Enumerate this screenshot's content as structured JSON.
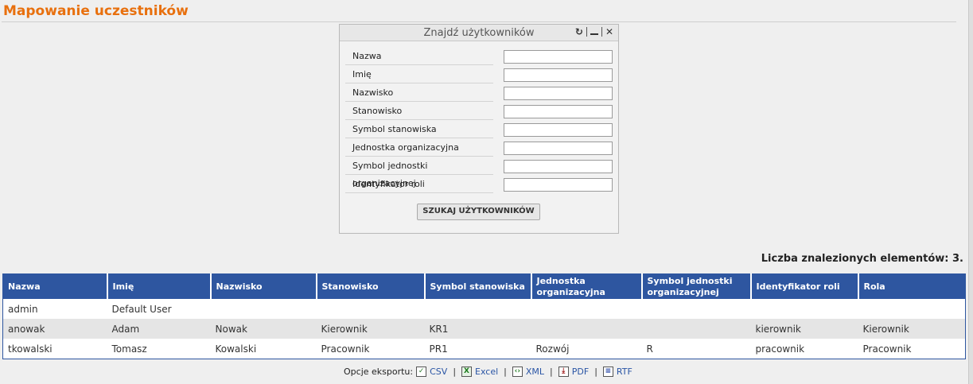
{
  "page": {
    "title": "Mapowanie uczestników"
  },
  "search_panel": {
    "title": "Znajdź użytkowników",
    "tools": {
      "refresh_icon": "↻",
      "close_icon": "✕"
    },
    "fields": [
      {
        "label": "Nazwa",
        "value": ""
      },
      {
        "label": "Imię",
        "value": ""
      },
      {
        "label": "Nazwisko",
        "value": ""
      },
      {
        "label": "Stanowisko",
        "value": ""
      },
      {
        "label": "Symbol stanowiska",
        "value": ""
      },
      {
        "label": "Jednostka organizacyjna",
        "value": ""
      },
      {
        "label": "Symbol jednostki organizacyjnej",
        "value": ""
      },
      {
        "label": "Identyfikator roli",
        "value": ""
      }
    ],
    "search_button": "SZUKAJ UŻYTKOWNIKÓW"
  },
  "results": {
    "count_text": "Liczba znalezionych elementów: 3.",
    "columns": [
      "Nazwa",
      "Imię",
      "Nazwisko",
      "Stanowisko",
      "Symbol stanowiska",
      "Jednostka organizacyjna",
      "Symbol jednostki organizacyjnej",
      "Identyfikator roli",
      "Rola"
    ],
    "rows": [
      [
        "admin",
        "Default User",
        "",
        "",
        "",
        "",
        "",
        "",
        ""
      ],
      [
        "anowak",
        "Adam",
        "Nowak",
        "Kierownik",
        "KR1",
        "",
        "",
        "kierownik",
        "Kierownik"
      ],
      [
        "tkowalski",
        "Tomasz",
        "Kowalski",
        "Pracownik",
        "PR1",
        "Rozwój",
        "R",
        "pracownik",
        "Pracownik"
      ]
    ]
  },
  "export": {
    "label": "Opcje eksportu:",
    "options": [
      {
        "label": "CSV",
        "icon": "csv-icon"
      },
      {
        "label": "Excel",
        "icon": "excel-icon"
      },
      {
        "label": "XML",
        "icon": "xml-icon"
      },
      {
        "label": "PDF",
        "icon": "pdf-icon"
      },
      {
        "label": "RTF",
        "icon": "rtf-icon"
      }
    ],
    "separator": "|"
  },
  "colors": {
    "accent": "#e8700e",
    "table_header": "#2e56a0",
    "link": "#2a55a5"
  }
}
